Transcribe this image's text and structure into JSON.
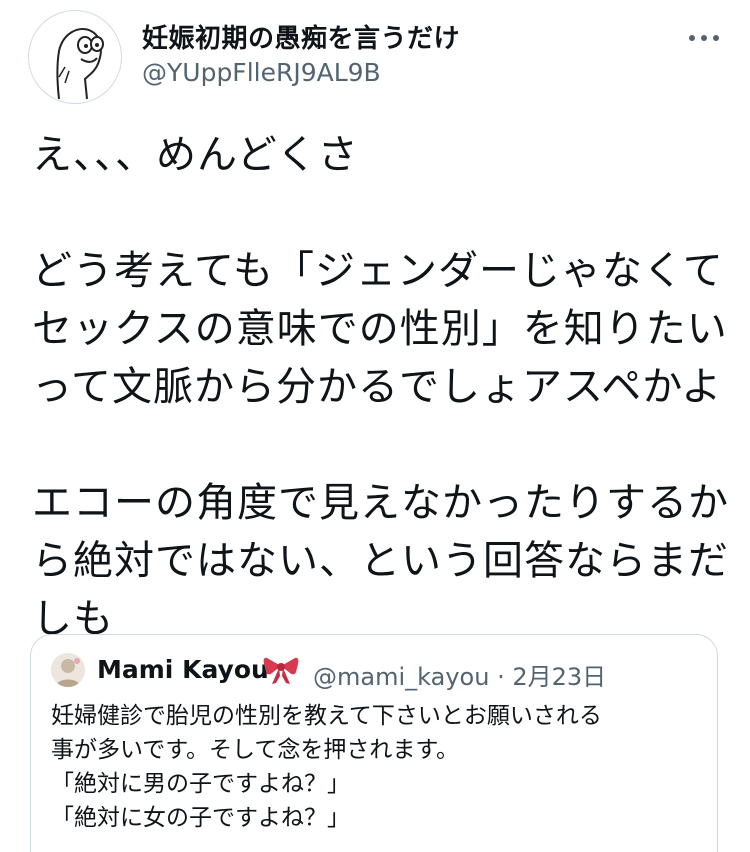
{
  "author": {
    "display_name": "妊娠初期の愚痴を言うだけ",
    "handle": "@YUppFlleRJ9AL9B",
    "avatar_icon": "cartoon-character-avatar"
  },
  "more_icon": "more-options-icon",
  "tweet": {
    "lines": [
      "え、、、めんどくさ",
      "",
      "どう考えても「ジェンダーじゃなくて",
      "セックスの意味での性別」を知りたい",
      "って文脈から分かるでしょアスペかよ",
      "",
      "エコーの角度で見えなかったりするか",
      "ら絶対ではない、という回答ならまだ",
      "しも"
    ]
  },
  "quoted_tweet": {
    "display_name": "Mami Kayou",
    "ribbon_emoji": "🎀",
    "handle": "@mami_kayou",
    "separator": "·",
    "date": "2月23日",
    "lines": [
      "妊婦健診で胎児の性別を教えて下さいとお願いされる",
      "事が多いです。そして念を押されます。",
      "「絶対に男の子ですよね？」",
      "「絶対に女の子ですよね？」"
    ]
  },
  "colors": {
    "text": "#0f1419",
    "secondary": "#536471",
    "border": "#cfd9de"
  }
}
